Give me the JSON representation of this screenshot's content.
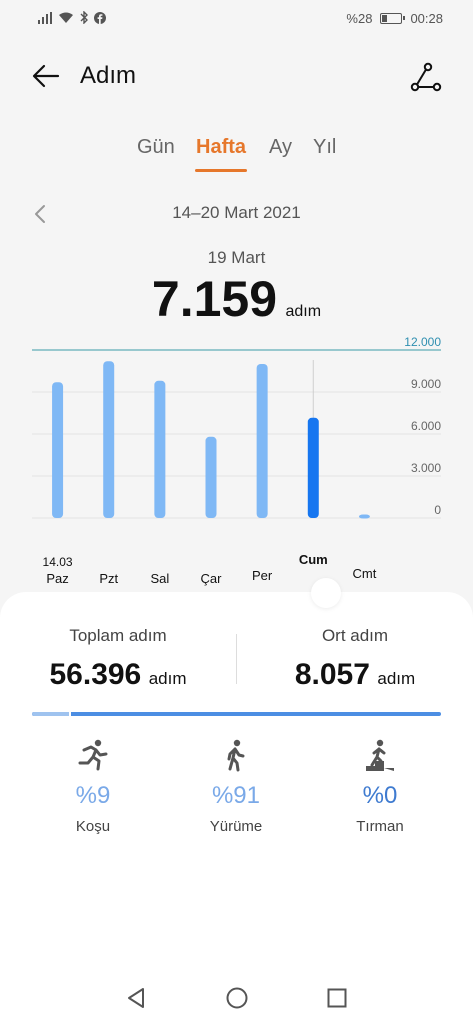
{
  "status_bar": {
    "battery": "%28",
    "time": "00:28",
    "battery_level": 0.28
  },
  "header": {
    "title": "Adım"
  },
  "tabs": [
    {
      "label": "Gün",
      "active": false
    },
    {
      "label": "Hafta",
      "active": true
    },
    {
      "label": "Ay",
      "active": false
    },
    {
      "label": "Yıl",
      "active": false
    }
  ],
  "date_range": "14–20 Mart 2021",
  "selected": {
    "date": "19 Mart",
    "value": "7.159",
    "unit": "adım"
  },
  "chart_data": {
    "type": "bar",
    "categories": [
      "Paz",
      "Pzt",
      "Sal",
      "Çar",
      "Per",
      "Cum",
      "Cmt"
    ],
    "first_date_label": "14.03",
    "values": [
      9700,
      11200,
      9800,
      5800,
      11000,
      7159,
      250
    ],
    "selected_index": 5,
    "ylim": [
      0,
      12000
    ],
    "y_ticks": [
      "0",
      "3.000",
      "6.000",
      "9.000",
      "12.000"
    ],
    "y_tick_values": [
      0,
      3000,
      6000,
      9000,
      12000
    ],
    "colors": {
      "bar": "#7fb8f5",
      "selected": "#1676f0",
      "target_line": "#3a9aa8",
      "target_label": "#2f8fb0"
    }
  },
  "summary": {
    "total": {
      "label": "Toplam adım",
      "value": "56.396",
      "unit": "adım"
    },
    "average": {
      "label": "Ort adım",
      "value": "8.057",
      "unit": "adım"
    }
  },
  "activity_share": {
    "run": 0.09,
    "walk": 0.91,
    "climb": 0.0
  },
  "activities": [
    {
      "icon": "running-icon",
      "percent": "%9",
      "label": "Koşu"
    },
    {
      "icon": "walking-icon",
      "percent": "%91",
      "label": "Yürüme"
    },
    {
      "icon": "climbing-icon",
      "percent": "%0",
      "label": "Tırman"
    }
  ]
}
